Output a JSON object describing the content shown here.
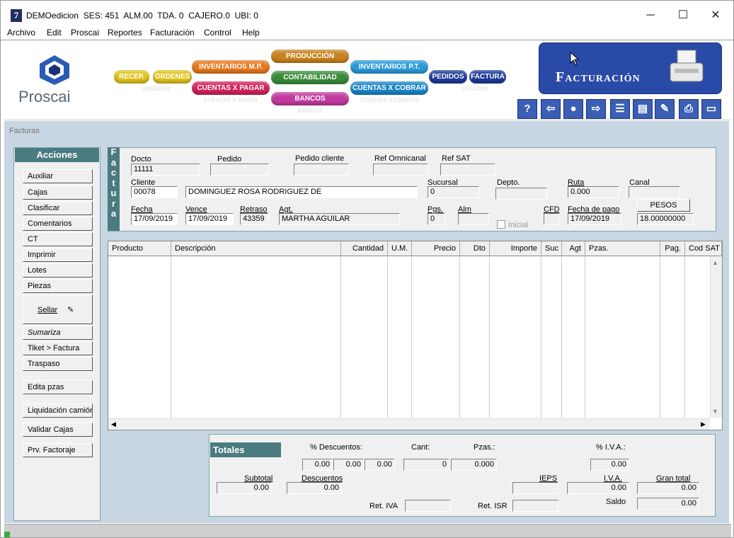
{
  "window": {
    "title": "DEMOedicion  SES: 451  ALM.00  TDA. 0  CAJERO.0  UBI: 0",
    "icon": "app-logo-icon",
    "minimize": "─",
    "maximize": "☐",
    "close": "✕"
  },
  "menu": [
    "Archivo",
    "Edit",
    "Proscai",
    "Reportes",
    "Facturación",
    "Control",
    "Help"
  ],
  "banner": {
    "logo_text": "Proscai",
    "modules": {
      "recep": "RECEP.",
      "ordenes": "ORDENES",
      "inventarios_mp": "INVENTARIOS M.P.",
      "cuentas_pagar": "CUENTAS X PAGAR",
      "produccion": "PRODUCCIÓN",
      "contabilidad": "CONTABILIDAD",
      "bancos": "BANCOS",
      "inventarios_pt": "INVENTARIOS P.T.",
      "cuentas_cobrar": "CUENTAS X COBRAR",
      "pedidos": "PEDIDOS",
      "factura": "FACTURA"
    },
    "title": "Facturación",
    "toolbar_icons": [
      "help-icon",
      "back-icon",
      "search-user-icon",
      "forward-icon",
      "list-icon",
      "notes-icon",
      "edit-icon",
      "print-icon",
      "window-icon"
    ],
    "toolbar_glyphs": [
      "?",
      "⇦",
      "●",
      "⇨",
      "☰",
      "▤",
      "✎",
      "⎙",
      "▭"
    ]
  },
  "breadcrumb": "Facturas",
  "acciones": {
    "title": "Acciones",
    "buttons": [
      "Auxiliar",
      "Cajas",
      "Clasificar",
      "Comentarios",
      "CT",
      "Imprimir",
      "Lotes",
      "Piezas",
      "Sellar",
      "Sumariza",
      "Tiket > Factura",
      "Traspaso",
      "Edita pzas",
      "Liquidación camión",
      "Validar Cajas",
      "Prv. Factoraje"
    ]
  },
  "factura": {
    "strip": [
      "F",
      "a",
      "c",
      "t",
      "u",
      "r",
      "a"
    ],
    "labels": {
      "docto": "Docto",
      "pedido": "Pedido",
      "pedido_cliente": "Pedido cliente",
      "ref_omni": "Ref Omnicanal",
      "ref_sat": "Ref SAT",
      "cliente": "Cliente",
      "sucursal": "Sucursal",
      "depto": "Depto.",
      "ruta": "Ruta",
      "canal": "Canal",
      "fecha": "Fecha",
      "vence": "Vence",
      "retraso": "Retraso",
      "agt": "Agt.",
      "pgs": "Pgs.",
      "alm": "Alm",
      "cfd": "CFD",
      "fecha_pago": "Fecha de pago",
      "inicial": "Inicial",
      "pesos": "PESOS"
    },
    "values": {
      "docto": "11111",
      "cliente": "00078",
      "cliente_nombre": "DOMINGUEZ ROSA RODRIGUEZ DE",
      "sucursal": "0",
      "ruta": "0.000",
      "fecha": "17/09/2019",
      "vence": "17/09/2019",
      "retraso": "43359",
      "agt": "MARTHA AGUILAR",
      "pgs": "0",
      "fecha_pago": "17/09/2019",
      "tipo_cambio": "18.00000000"
    }
  },
  "grid": {
    "columns": [
      "Producto",
      "Descripción",
      "Cantidad",
      "U.M.",
      "Precio",
      "Dto",
      "Importe",
      "Suc",
      "Agt",
      "Pzas.",
      "Pag.",
      "Cod SAT"
    ]
  },
  "totales": {
    "title": "Totales",
    "labels": {
      "desc_pct": "% Descuentos:",
      "cant": "Cant:",
      "pzas": "Pzas.:",
      "iva_pct": "% I.V.A.:",
      "subtotal": "Subtotal",
      "descuentos": "Descuentos",
      "ieps": "IEPS",
      "iva": "I.V.A.",
      "gran_total": "Gran total",
      "ret_iva": "Ret. IVA",
      "ret_isr": "Ret. ISR",
      "saldo": "Saldo"
    },
    "values": {
      "desc1": "0.00",
      "desc2": "0.00",
      "desc3": "0.00",
      "cant": "0",
      "pzas": "0.000",
      "iva_pct": "0.00",
      "subtotal": "0.00",
      "descuentos": "0.00",
      "iva": "0.00",
      "gran_total": "0.00",
      "saldo": "0.00"
    }
  },
  "colors": {
    "accent": "#4a7b80",
    "banner_blue": "#2a4aa8",
    "client_bg": "#c8d5e3"
  }
}
